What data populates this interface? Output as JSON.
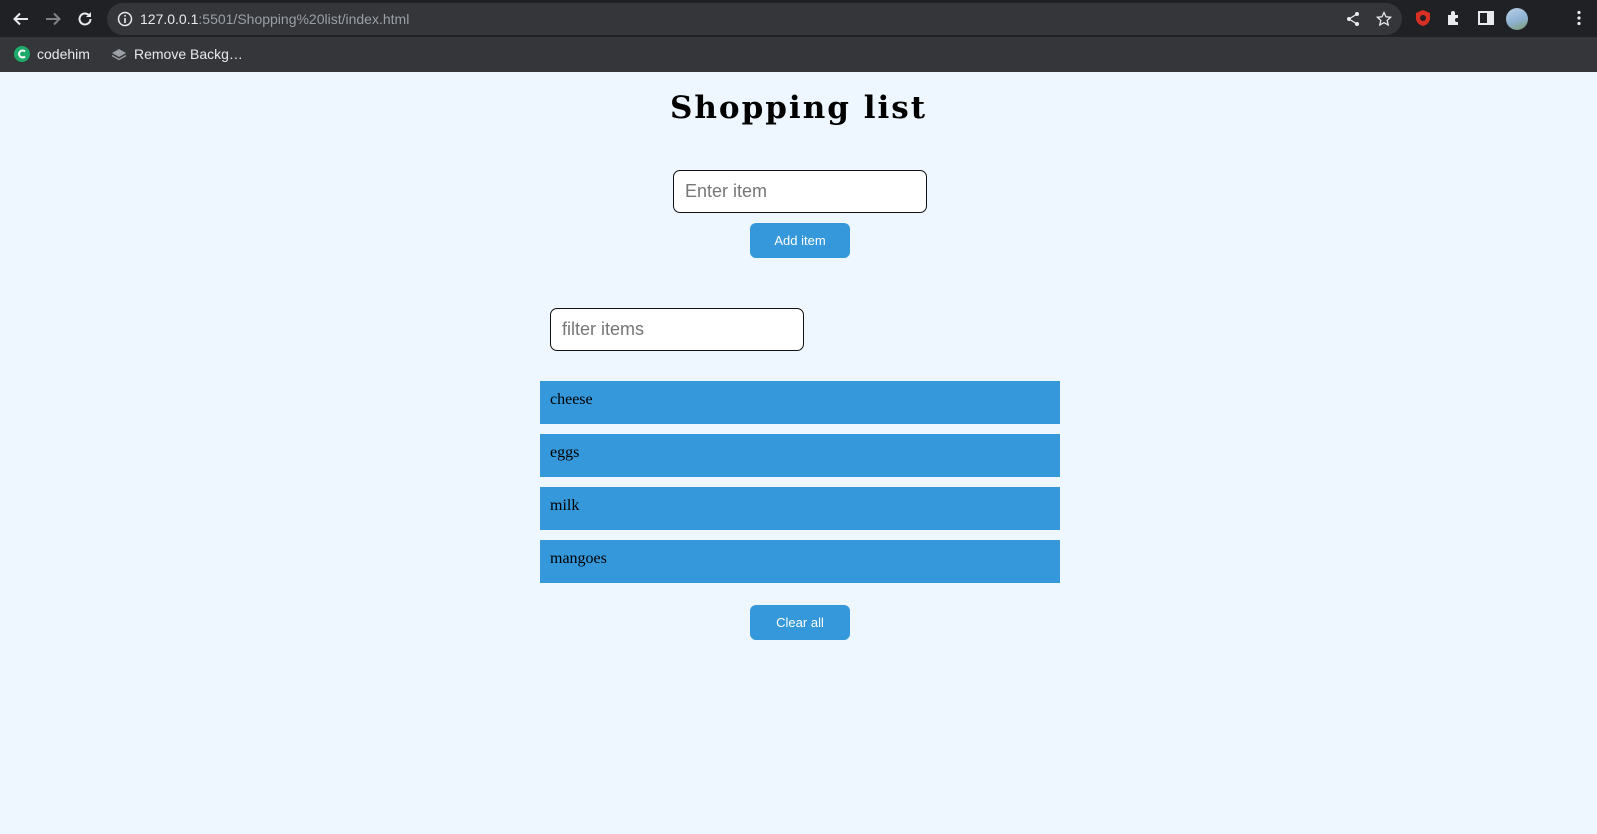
{
  "browser": {
    "url_host": "127.0.0.1",
    "url_rest": ":5501/Shopping%20list/index.html",
    "bookmarks": [
      {
        "label": "codehim",
        "icon": "codehim-icon"
      },
      {
        "label": "Remove Backg…",
        "icon": "layers-icon"
      }
    ]
  },
  "page": {
    "title": "Shopping list",
    "item_input_placeholder": "Enter item",
    "add_button_label": "Add item",
    "filter_placeholder": "filter items",
    "items": [
      "cheese",
      "eggs",
      "milk",
      "mangoes"
    ],
    "clear_button_label": "Clear all"
  },
  "colors": {
    "page_background": "#eef7ff",
    "accent": "#3498db",
    "chrome_dark": "#202124"
  }
}
